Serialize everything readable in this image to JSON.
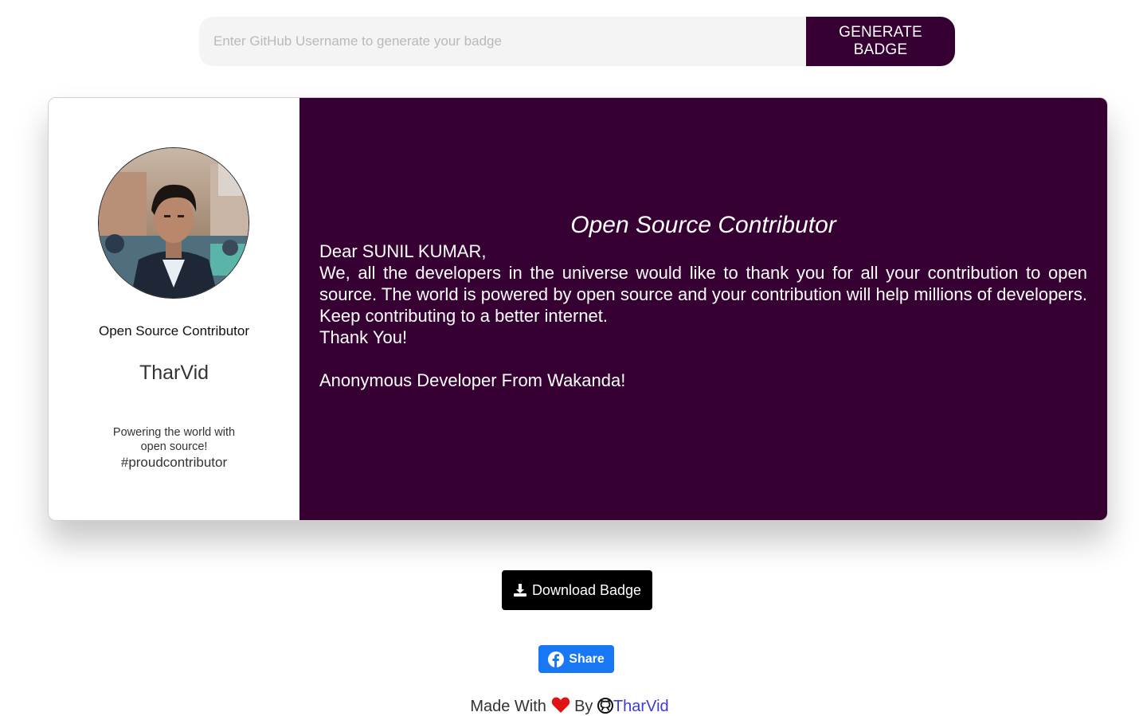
{
  "search": {
    "placeholder": "Enter GitHub Username to generate your badge",
    "value": "",
    "button_label": "GENERATE BADGE"
  },
  "badge": {
    "left": {
      "avatar_alt": "Profile photo of TharVid",
      "role": "Open Source Contributor",
      "username": "TharVid",
      "tagline": "Powering the world with open source!",
      "hashtag": "#proudcontributor"
    },
    "right": {
      "title": "Open Source Contributor",
      "greeting": "Dear SUNIL KUMAR,",
      "message": "We, all the developers in the universe would like to thank you for all your contribution to open source. The world is powered by open source and your contribution will help millions of developers. Keep contributing to a better internet.",
      "closing": "Thank You!",
      "signature": "Anonymous Developer From Wakanda!"
    },
    "colors": {
      "accent": "#360033"
    }
  },
  "actions": {
    "download_label": "Download Badge",
    "share_label": "Share"
  },
  "footer": {
    "made_with": "Made With",
    "by": "By",
    "author_link": "TharVid"
  },
  "icons": {
    "download": "download-icon",
    "facebook": "facebook-icon",
    "heart": "heart-icon",
    "github": "github-icon"
  }
}
